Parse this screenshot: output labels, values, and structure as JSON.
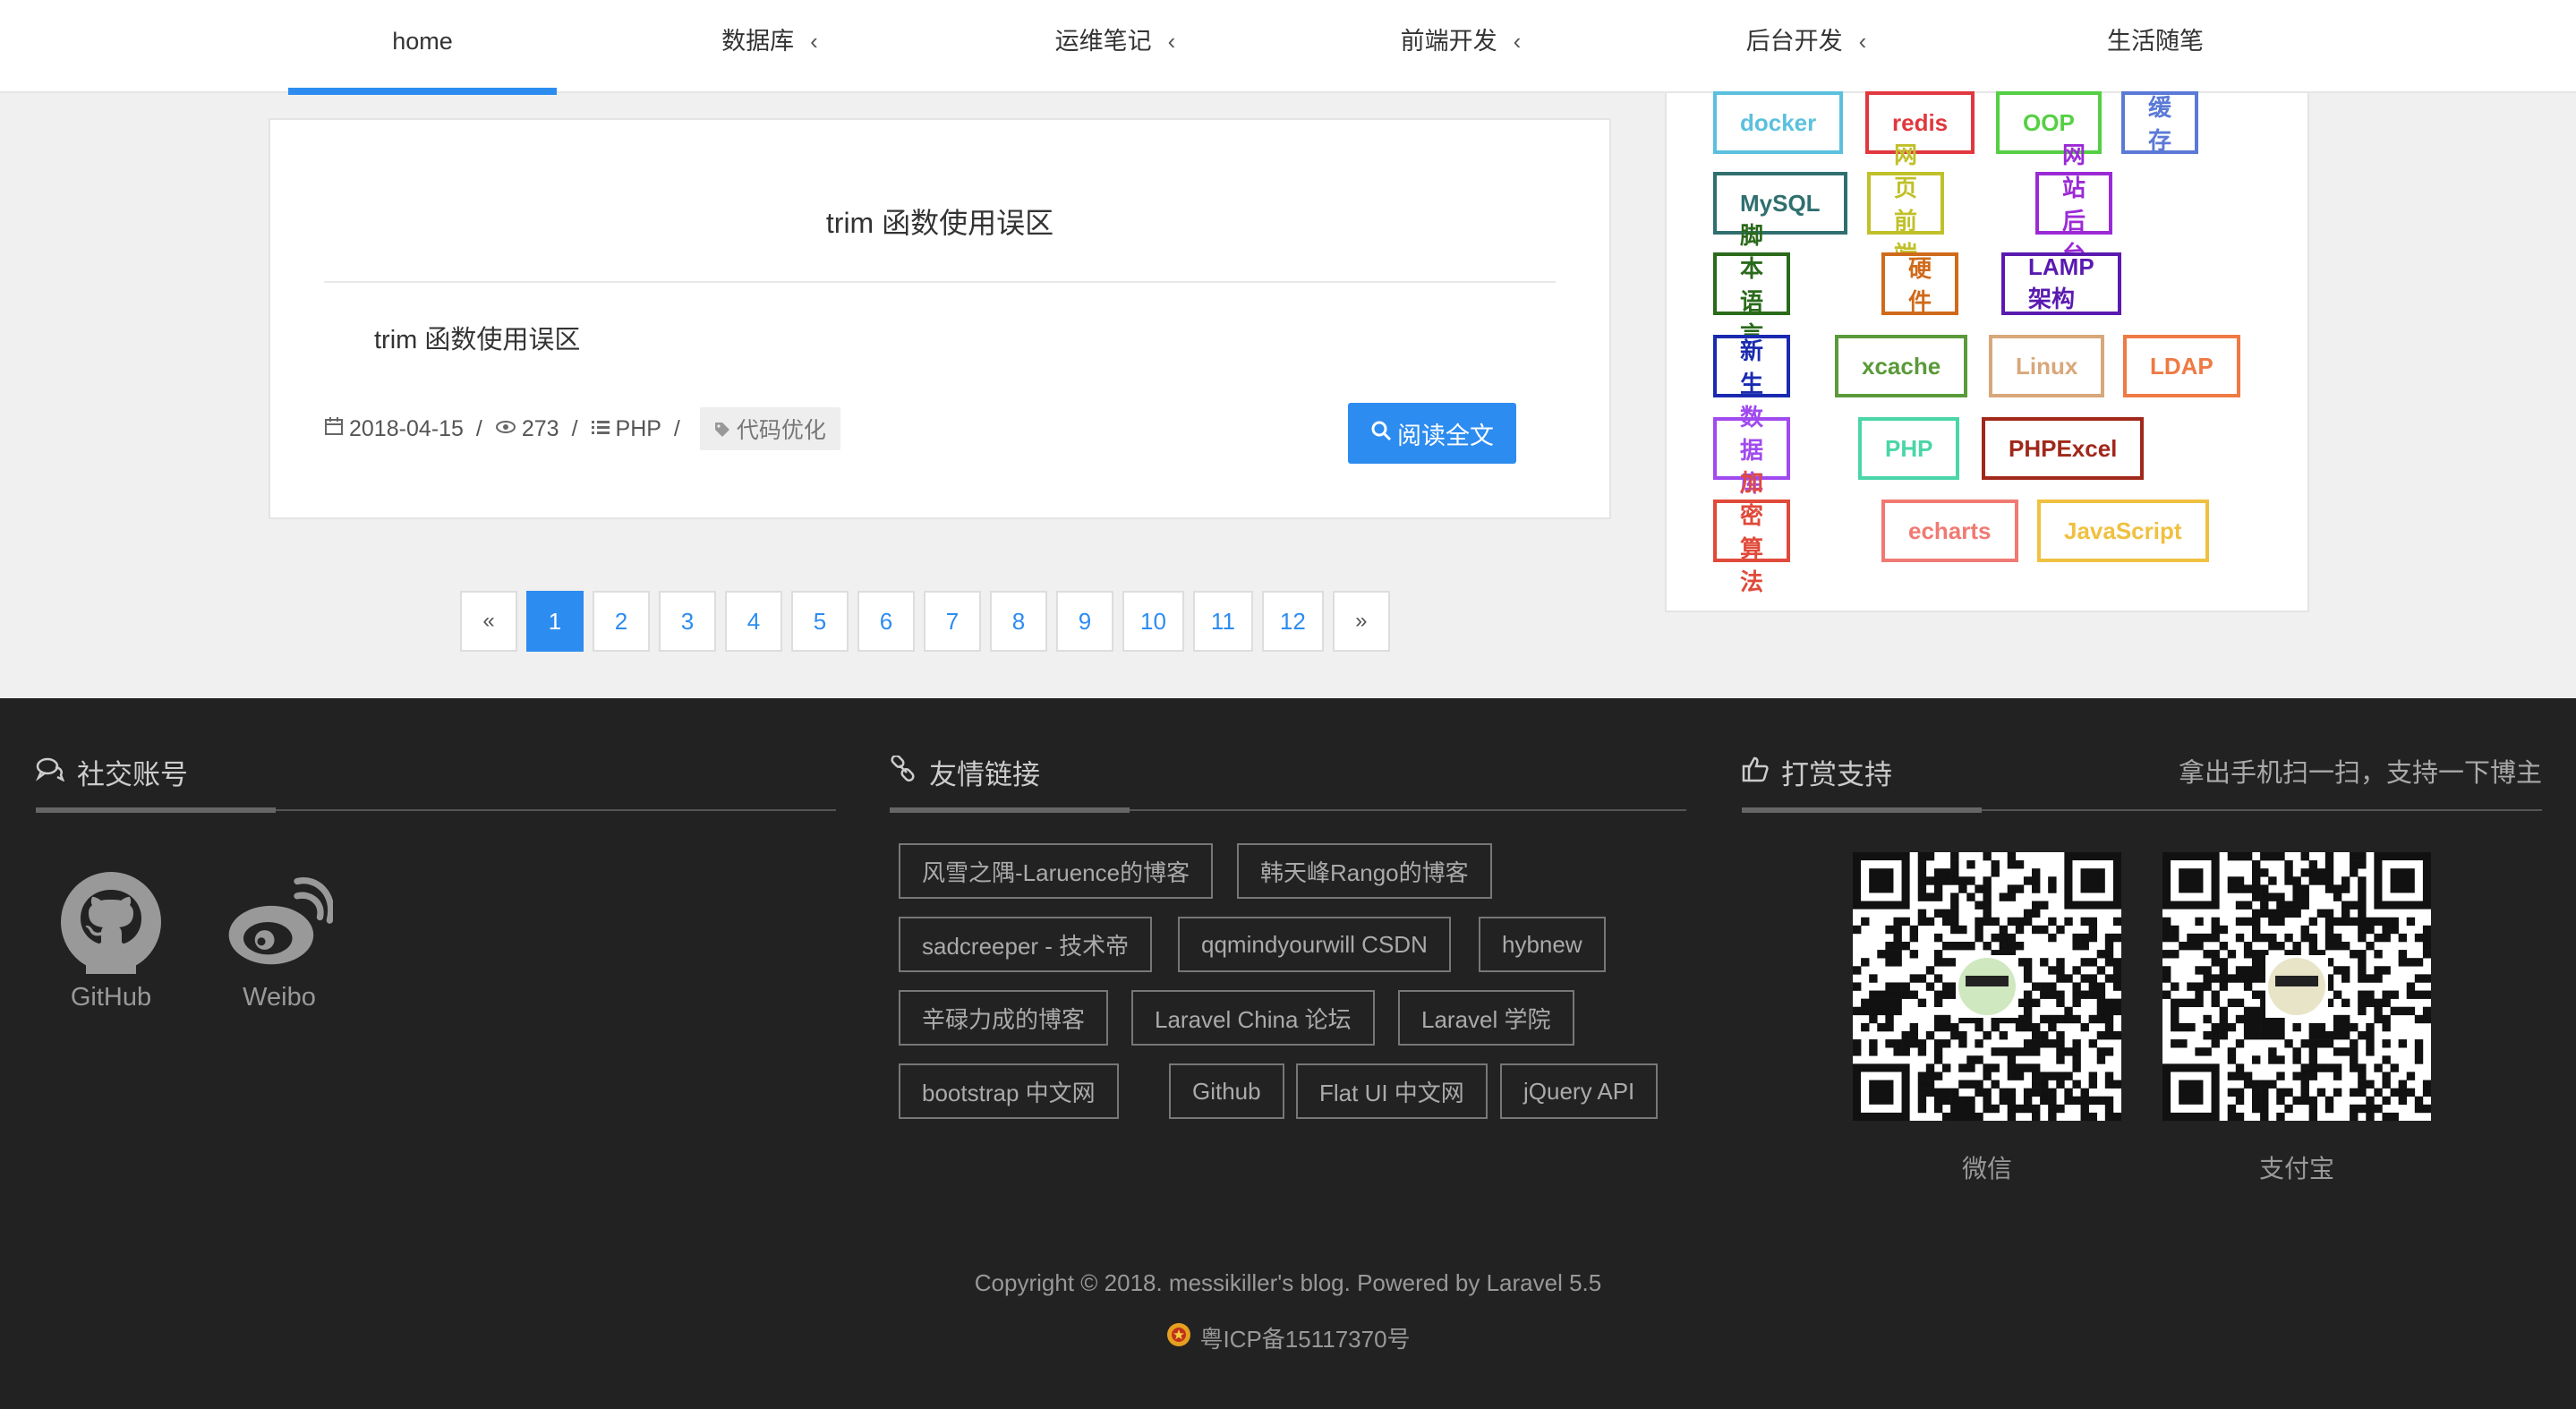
{
  "nav": {
    "items": [
      {
        "label": "home",
        "dropdown": false,
        "active": true
      },
      {
        "label": "数据库",
        "dropdown": true,
        "active": false
      },
      {
        "label": "运维笔记",
        "dropdown": true,
        "active": false
      },
      {
        "label": "前端开发",
        "dropdown": true,
        "active": false
      },
      {
        "label": "后台开发",
        "dropdown": true,
        "active": false
      },
      {
        "label": "生活随笔",
        "dropdown": false,
        "active": false
      }
    ],
    "chevron": "‹"
  },
  "article": {
    "title": "trim 函数使用误区",
    "excerpt": "trim 函数使用误区",
    "date": "2018-04-15",
    "views": "273",
    "category": "PHP",
    "tag": "代码优化",
    "read_more": "阅读全文",
    "separator": "/"
  },
  "pagination": {
    "prev": "«",
    "next": "»",
    "pages": [
      "1",
      "2",
      "3",
      "4",
      "5",
      "6",
      "7",
      "8",
      "9",
      "10",
      "11",
      "12"
    ],
    "current": "1"
  },
  "tags": [
    {
      "label": "docker",
      "color": "#5bc0de"
    },
    {
      "label": "redis",
      "color": "#e0383e"
    },
    {
      "label": "OOP",
      "color": "#55d044"
    },
    {
      "label": "缓存",
      "color": "#5b79d6"
    },
    {
      "label": "MySQL",
      "color": "#2f6f6f"
    },
    {
      "label": "网页前端",
      "color": "#c0c02a"
    },
    {
      "label": "网站后台",
      "color": "#9b2ad6"
    },
    {
      "label": "脚本语言",
      "color": "#2a6a1a"
    },
    {
      "label": "硬件",
      "color": "#d06a1a"
    },
    {
      "label": "LAMP架构",
      "color": "#5a1ab0"
    },
    {
      "label": "新生",
      "color": "#1a2ab0"
    },
    {
      "label": "xcache",
      "color": "#5a9a3a"
    },
    {
      "label": "Linux",
      "color": "#d8a77a"
    },
    {
      "label": "LDAP",
      "color": "#ee7a44"
    },
    {
      "label": "数据库",
      "color": "#a04af0"
    },
    {
      "label": "PHP",
      "color": "#4ad6a8"
    },
    {
      "label": "PHPExcel",
      "color": "#a0281a"
    },
    {
      "label": "加密算法",
      "color": "#e04a3a"
    },
    {
      "label": "echarts",
      "color": "#f07a72"
    },
    {
      "label": "JavaScript",
      "color": "#f0c040"
    }
  ],
  "footer": {
    "social": {
      "title": "社交账号",
      "items": [
        {
          "label": "GitHub",
          "icon": "github-icon"
        },
        {
          "label": "Weibo",
          "icon": "weibo-icon"
        }
      ]
    },
    "links": {
      "title": "友情链接",
      "items": [
        "风雪之隅-Laruence的博客",
        "韩天峰Rango的博客",
        "sadcreeper - 技术帝",
        "qqmindyourwill CSDN",
        "hybnew",
        "辛碌力成的博客",
        "Laravel China 论坛",
        "Laravel 学院",
        "bootstrap 中文网",
        "Github",
        "Flat UI 中文网",
        "jQuery API"
      ]
    },
    "donate": {
      "title": "打赏支持",
      "subtitle": "拿出手机扫一扫，支持一下博主",
      "wechat_label": "微信",
      "alipay_label": "支付宝"
    },
    "copyright": "Copyright © 2018. messikiller's blog. Powered by Laravel 5.5",
    "icp": "粤ICP备15117370号"
  },
  "colors": {
    "accent": "#2d8cf0",
    "footer_bg": "#222222",
    "page_bg": "#f0f0f0"
  }
}
